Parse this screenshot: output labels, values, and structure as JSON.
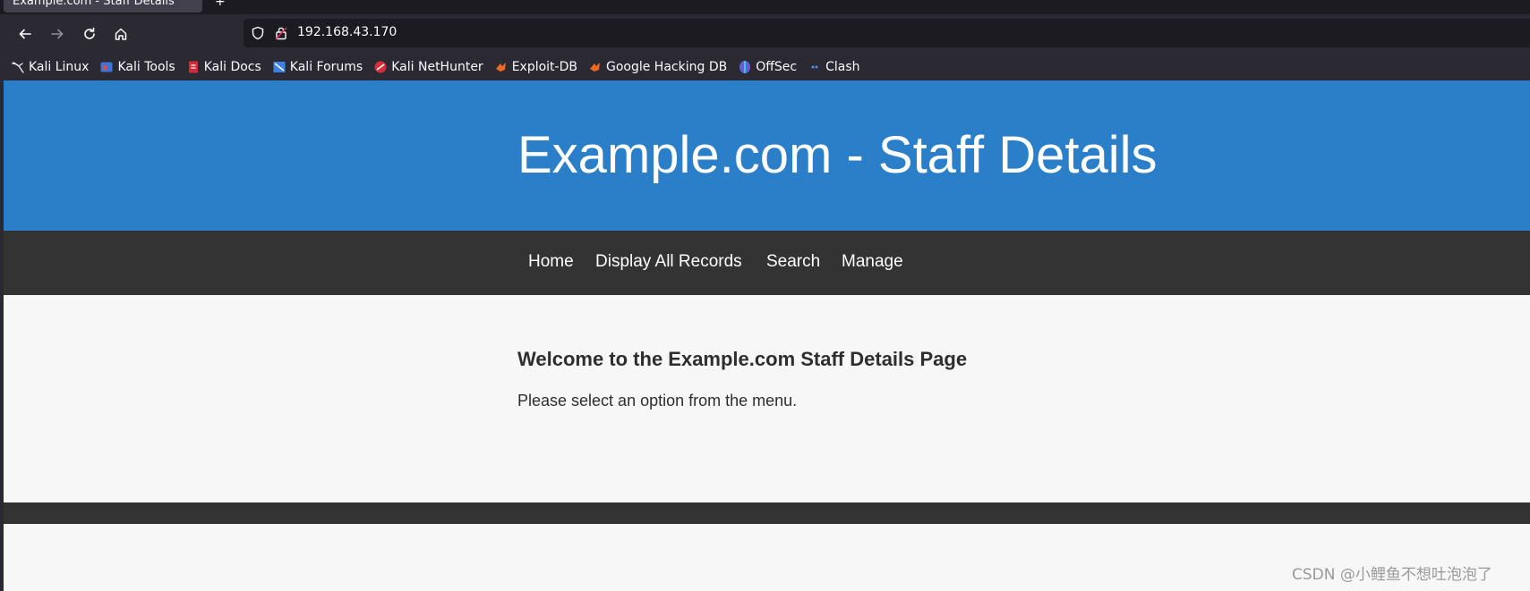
{
  "browser": {
    "tab_title": "Example.com - Staff Details",
    "new_tab_label": "+",
    "url": "192.168.43.170",
    "bookmarks": [
      {
        "label": "Kali Linux",
        "icon": "kali-dragon-icon"
      },
      {
        "label": "Kali Tools",
        "icon": "kali-tools-icon"
      },
      {
        "label": "Kali Docs",
        "icon": "kali-docs-icon"
      },
      {
        "label": "Kali Forums",
        "icon": "kali-forums-icon"
      },
      {
        "label": "Kali NetHunter",
        "icon": "kali-nethunter-icon"
      },
      {
        "label": "Exploit-DB",
        "icon": "exploit-db-icon"
      },
      {
        "label": "Google Hacking DB",
        "icon": "google-hacking-db-icon"
      },
      {
        "label": "OffSec",
        "icon": "offsec-icon"
      },
      {
        "label": "Clash",
        "icon": "clash-icon"
      }
    ]
  },
  "site": {
    "title": "Example.com - Staff Details",
    "nav": [
      {
        "label": "Home"
      },
      {
        "label": "Display All Records"
      },
      {
        "label": "Search"
      },
      {
        "label": "Manage"
      }
    ],
    "heading": "Welcome to the Example.com Staff Details Page",
    "text": "Please select an option from the menu."
  },
  "watermark": "CSDN @小鲤鱼不想吐泡泡了",
  "colors": {
    "header_blue": "#2b7fc9",
    "nav_dark": "#333333",
    "chrome_dark": "#2b2a33"
  }
}
